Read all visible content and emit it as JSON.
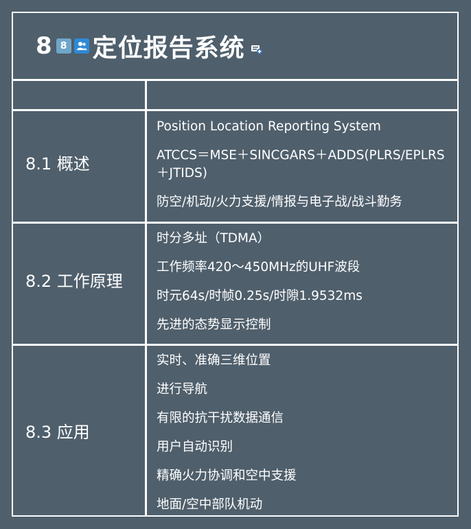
{
  "title": {
    "number": "8",
    "badge_number": "8",
    "text": "定位报告系统"
  },
  "sections": [
    {
      "label": "8.1 概述",
      "items": [
        "Position Location Reporting System",
        "ATCCS＝MSE＋SINCGARS＋ADDS(PLRS/EPLRS",
        "＋JTIDS)",
        "防空/机动/火力支援/情报与电子战/战斗勤务"
      ]
    },
    {
      "label": "8.2 工作原理",
      "items": [
        "时分多址（TDMA）",
        "工作频率420～450MHz的UHF波段",
        "时元64s/时帧0.25s/时隙1.9532ms",
        "先进的态势显示控制"
      ]
    },
    {
      "label": "8.3 应用",
      "items": [
        "实时、准确三维位置",
        "进行导航",
        "有限的抗干扰数据通信",
        "用户自动识别",
        "精确火力协调和空中支援",
        "地面/空中部队机动"
      ]
    }
  ]
}
